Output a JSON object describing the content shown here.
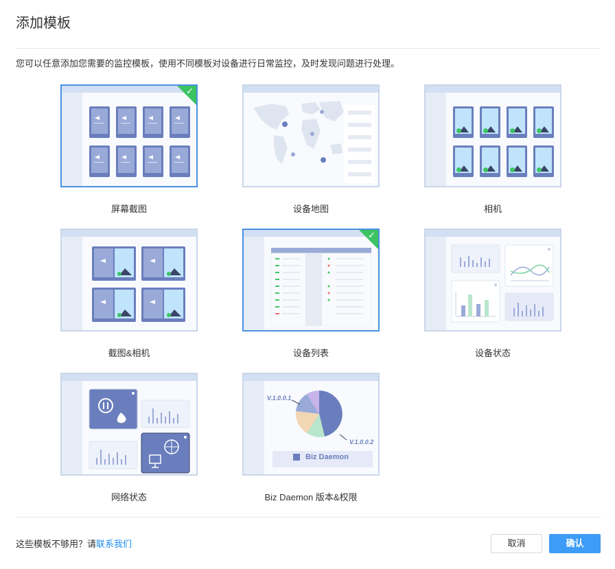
{
  "dialog": {
    "title": "添加模板",
    "description": "您可以任意添加您需要的监控模板，使用不同模板对设备进行日常监控，及时发现问题进行处理。"
  },
  "templates": [
    {
      "label": "屏幕截图",
      "selected": true
    },
    {
      "label": "设备地图",
      "selected": false
    },
    {
      "label": "相机",
      "selected": false
    },
    {
      "label": "截图&相机",
      "selected": false
    },
    {
      "label": "设备列表",
      "selected": true
    },
    {
      "label": "设备状态",
      "selected": false
    },
    {
      "label": "网络状态",
      "selected": false
    },
    {
      "label": "Biz Daemon 版本&权限",
      "selected": false
    }
  ],
  "thumbs": {
    "version_a": "V.1.0.0.1",
    "version_b": "V.1.0.0.2",
    "biz_daemon": "Biz Daemon"
  },
  "footer": {
    "hint": "这些模板不够用？请",
    "link": "联系我们",
    "cancel": "取消",
    "confirm": "确认"
  },
  "colors": {
    "accent": "#3d9cf5",
    "selected_border": "#4a90e2",
    "check": "#3cc463",
    "link": "#1f8cf0"
  }
}
